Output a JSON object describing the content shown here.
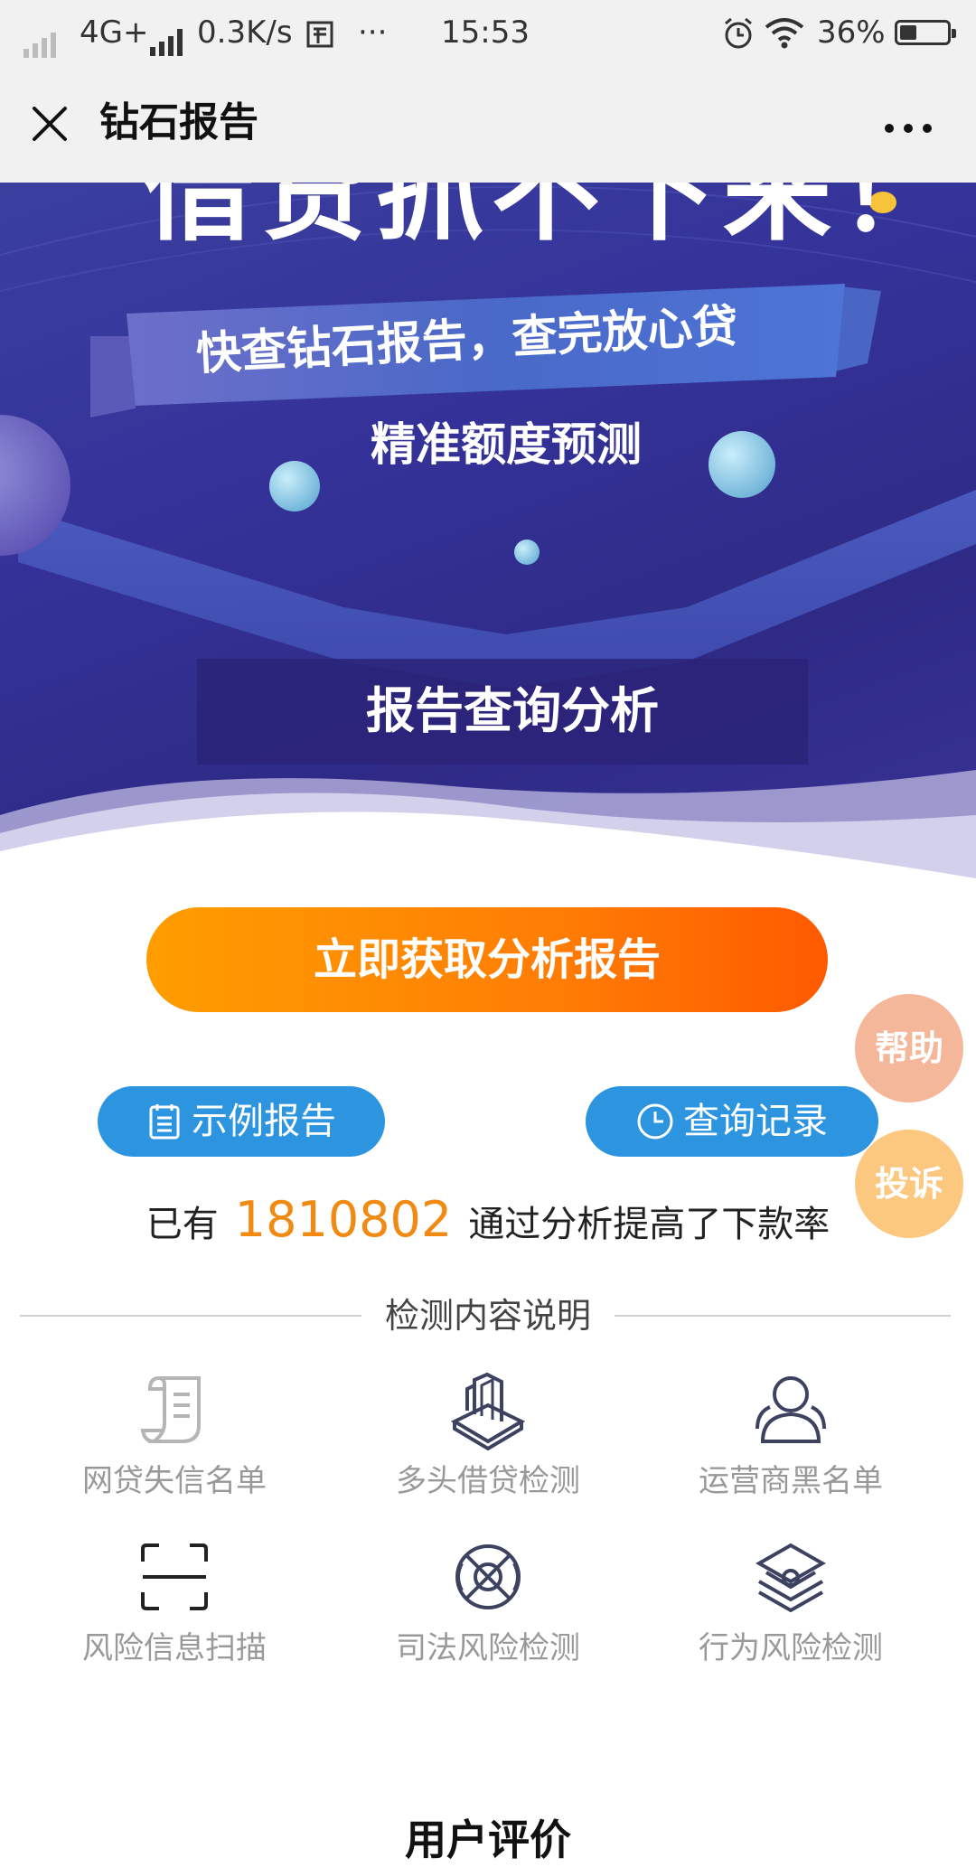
{
  "status_bar": {
    "network": "4G+",
    "speed": "0.3K/s",
    "overflow": "···",
    "time": "15:53",
    "battery": "36%",
    "battery_level": 0.36
  },
  "title_bar": {
    "title": "钻石报告",
    "more_label": "···"
  },
  "banner": {
    "headline": "借贷抓不下来！",
    "ribbon_text": "快查钻石报告，查完放心贷",
    "subtitle": "精准额度预测",
    "box_text": "报告查询分析"
  },
  "actions": {
    "primary_cta": "立即获取分析报告",
    "sample_report": "示例报告",
    "query_history": "查询记录"
  },
  "floating": {
    "help": "帮助",
    "complain": "投诉"
  },
  "stats": {
    "prefix": "已有",
    "count": "1810802",
    "suffix": "通过分析提高了下款率"
  },
  "features_section": {
    "title": "检测内容说明",
    "items": [
      {
        "label": "网贷失信名单",
        "icon": "document-list-icon",
        "active": false
      },
      {
        "label": "多头借贷检测",
        "icon": "stacked-files-icon",
        "active": true
      },
      {
        "label": "运营商黑名单",
        "icon": "users-icon",
        "active": true
      },
      {
        "label": "风险信息扫描",
        "icon": "scan-frame-icon",
        "active": true
      },
      {
        "label": "司法风险检测",
        "icon": "globe-gavel-icon",
        "active": true
      },
      {
        "label": "行为风险检测",
        "icon": "cube-refresh-icon",
        "active": true
      }
    ]
  },
  "next_section": {
    "title": "用户评价"
  },
  "colors": {
    "cta_start": "#ff9d00",
    "cta_end": "#ff5a00",
    "pill_blue": "#2d95e0",
    "count_orange": "#f08a13",
    "help_bg": "#f4b79a",
    "complain_bg": "#fcc77e"
  }
}
